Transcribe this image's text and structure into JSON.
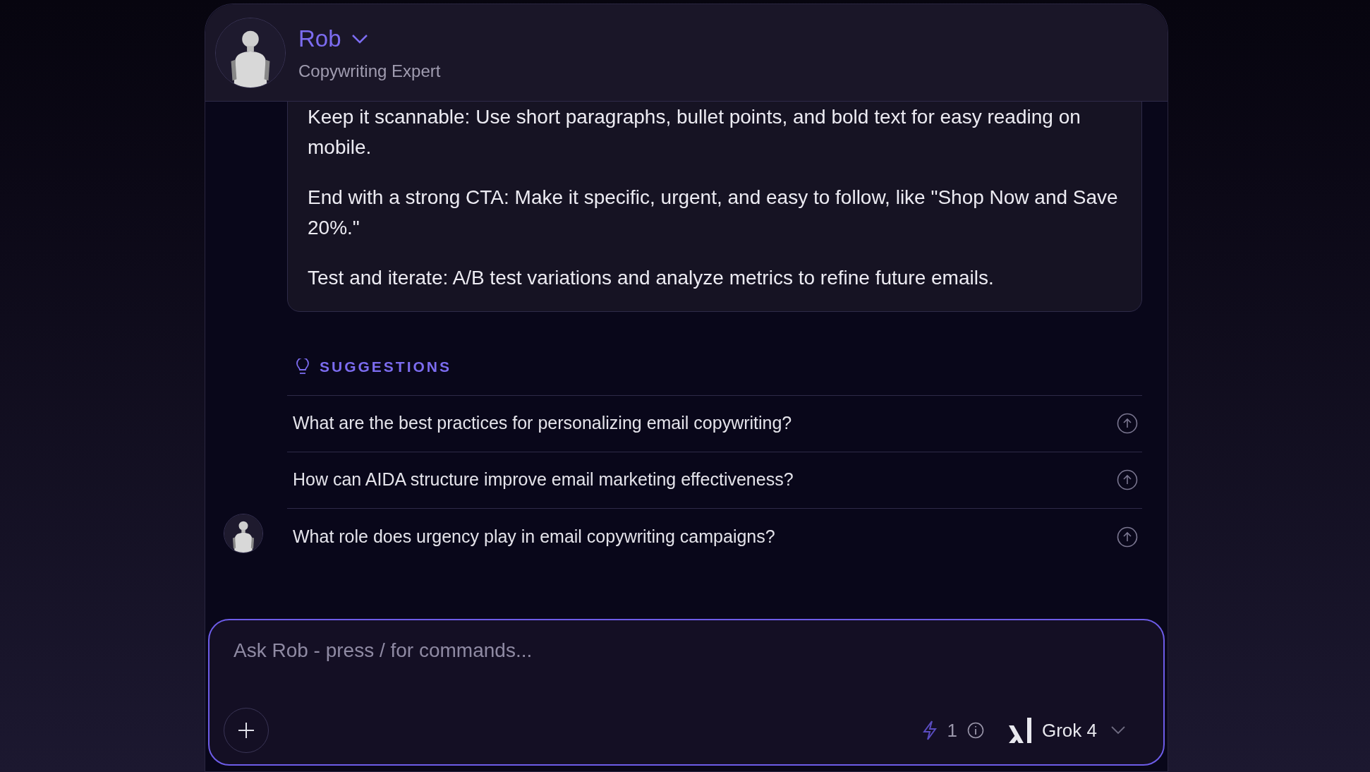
{
  "header": {
    "name": "Rob",
    "subtitle": "Copywriting Expert"
  },
  "message": {
    "paragraphs": [
      "Keep it scannable: Use short paragraphs, bullet points, and bold text for easy reading on mobile.",
      "End with a strong CTA: Make it specific, urgent, and easy to follow, like \"Shop Now and Save 20%.\"",
      "Test and iterate: A/B test variations and analyze metrics to refine future emails."
    ]
  },
  "suggestions": {
    "title": "SUGGESTIONS",
    "items": [
      "What are the best practices for personalizing email copywriting?",
      "How can AIDA structure improve email marketing effectiveness?",
      "What role does urgency play in email copywriting campaigns?"
    ]
  },
  "composer": {
    "placeholder": "Ask Rob - press / for commands...",
    "credits": "1",
    "model": "Grok 4"
  }
}
